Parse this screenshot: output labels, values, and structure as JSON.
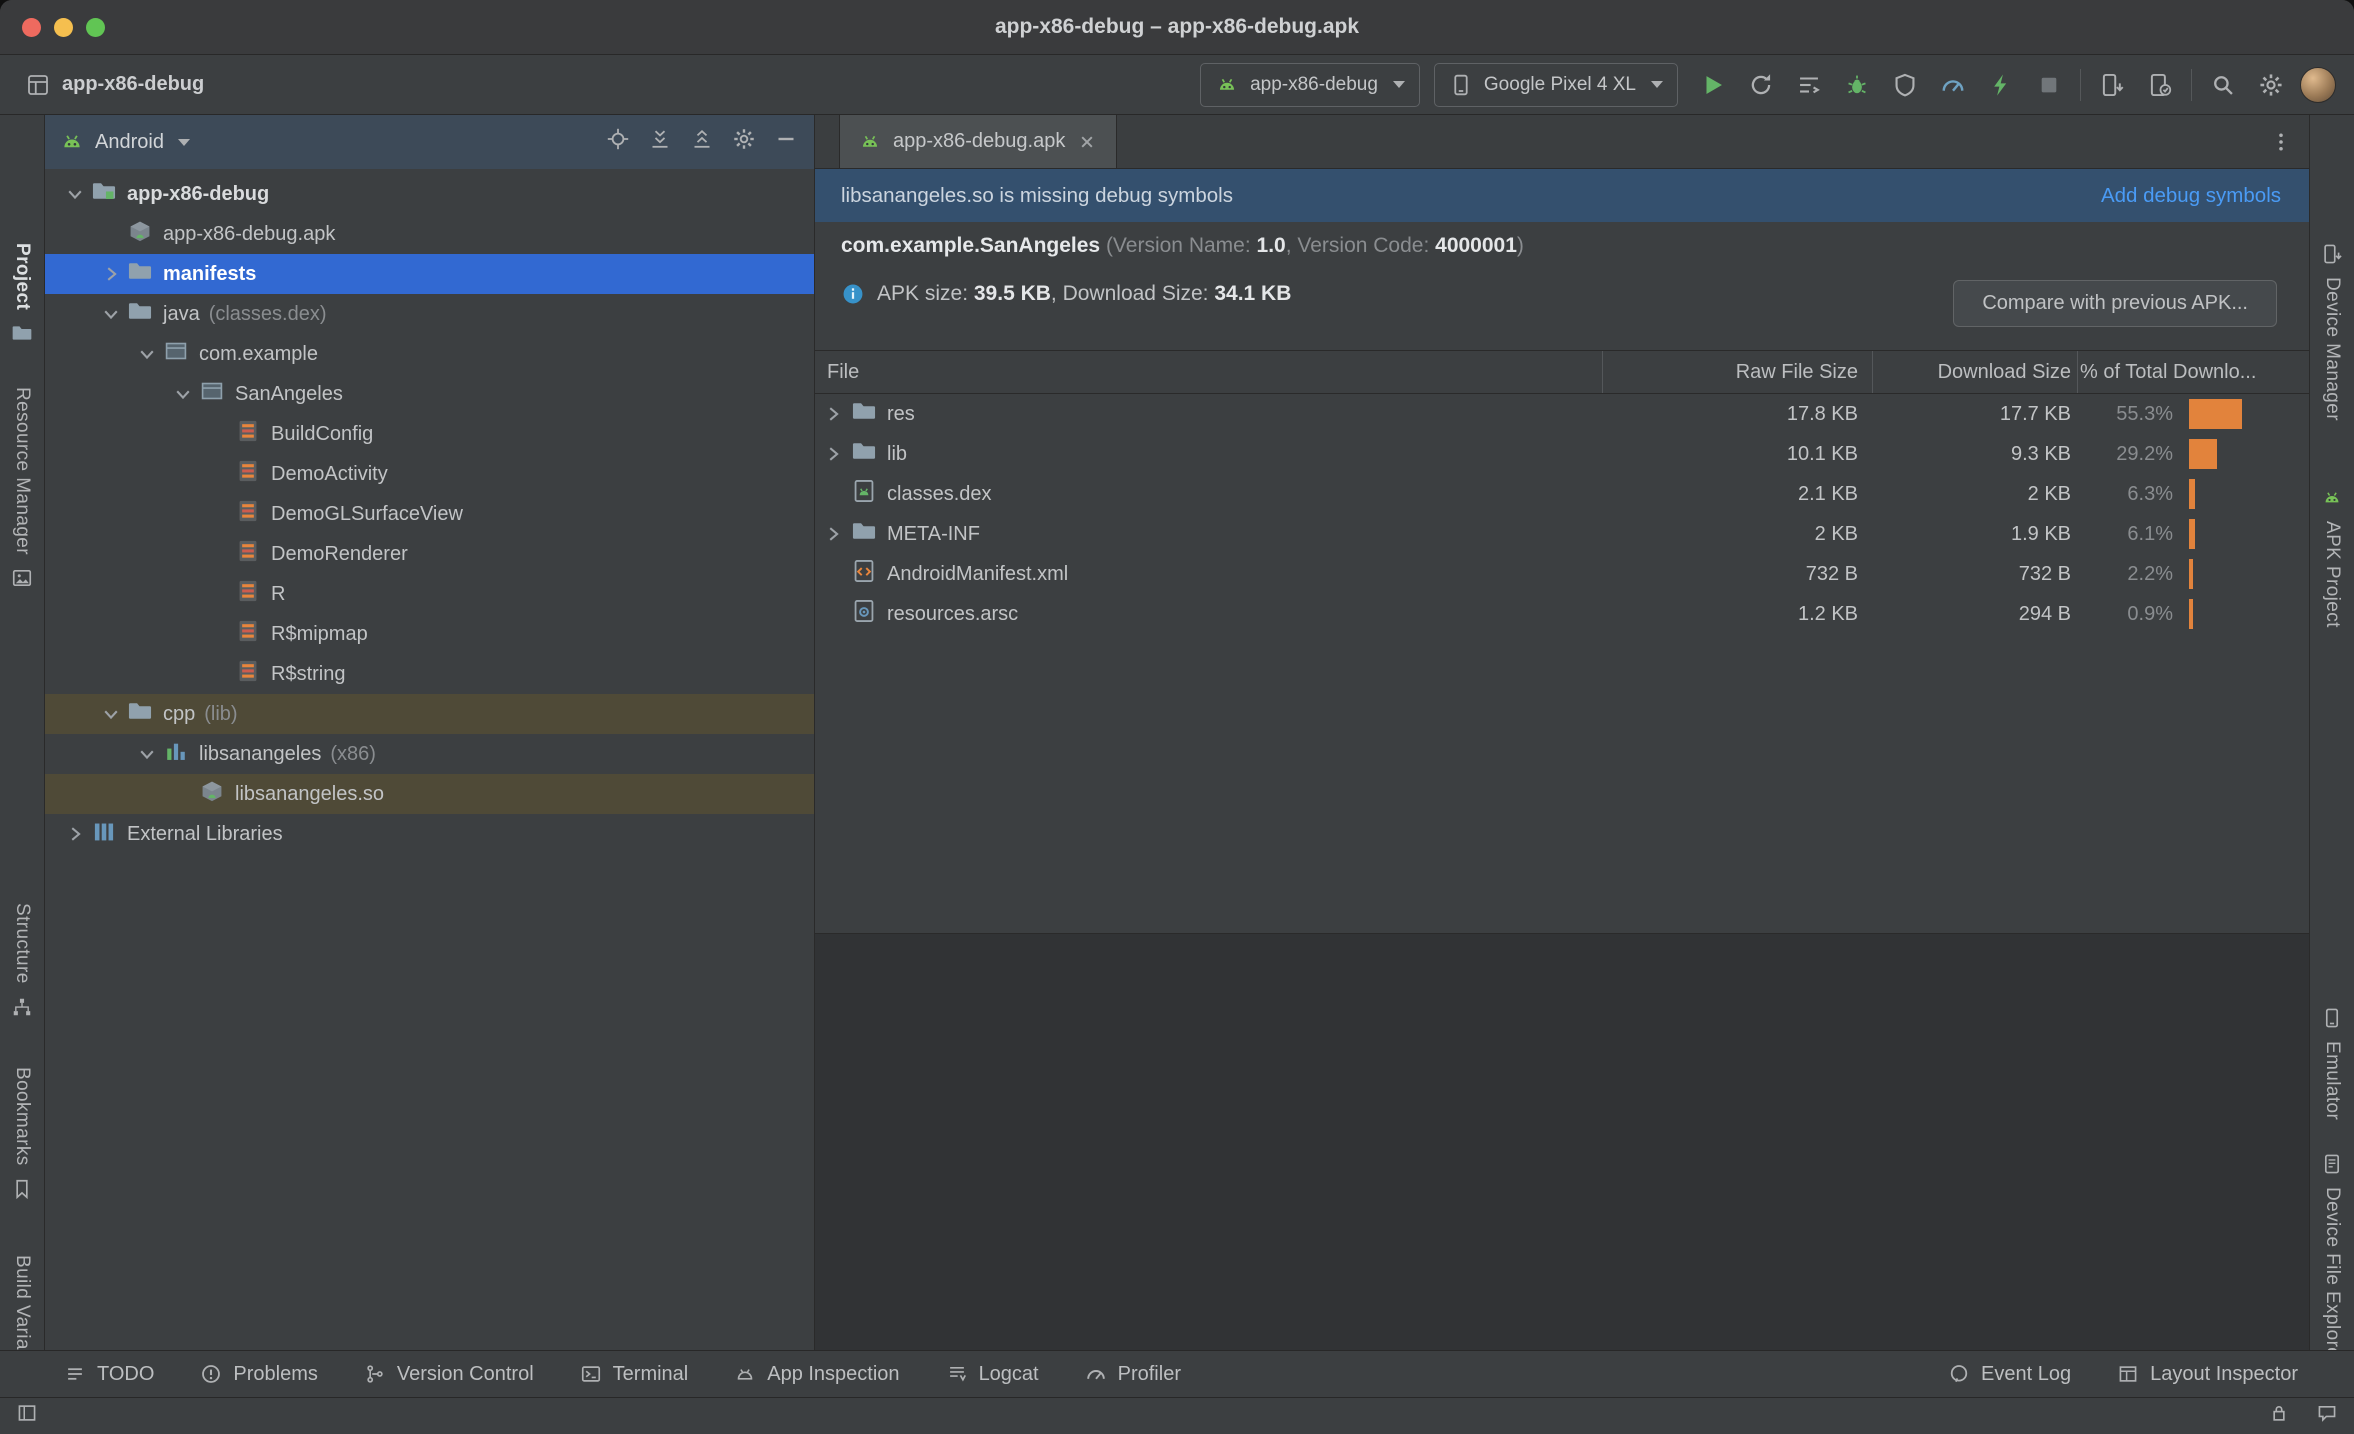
{
  "window": {
    "title": "app-x86-debug – app-x86-debug.apk"
  },
  "colors": {
    "selection_blue": "#3269d2",
    "flag_olive": "#4f4a37",
    "attention_orange": "#e2833c",
    "link_blue": "#4a9bf5",
    "banner_blue": "#34506e",
    "android_green": "#78c257"
  },
  "toolbar": {
    "project_name": "app-x86-debug",
    "run_config": {
      "label": "app-x86-debug",
      "icon": "android-icon"
    },
    "device_selector": {
      "label": "Google Pixel 4 XL",
      "icon": "phone-icon"
    },
    "action_icons": [
      "run-icon",
      "apply-changes-icon",
      "apply-code-changes-icon",
      "debug-icon",
      "attach-debugger-icon",
      "profile-icon",
      "profile-low-overhead-icon",
      "stop-icon"
    ],
    "device_icons": [
      "device-manager-icon",
      "running-devices-icon"
    ],
    "global_icons": [
      "search-icon",
      "settings-icon"
    ]
  },
  "left_stripe": {
    "items": [
      {
        "label": "Project",
        "icon": "folder-icon",
        "active": true
      },
      {
        "label": "Resource Manager",
        "icon": "resource-manager-icon"
      },
      {
        "label": "Structure",
        "icon": "structure-icon"
      },
      {
        "label": "Bookmarks",
        "icon": "bookmarks-icon"
      },
      {
        "label": "Build Variants",
        "icon": "build-variants-icon"
      }
    ]
  },
  "right_stripe": {
    "items": [
      {
        "label": "Device Manager",
        "icon": "device-manager-icon"
      },
      {
        "label": "APK Project",
        "icon": "android-icon"
      },
      {
        "label": "Emulator",
        "icon": "phone-icon"
      },
      {
        "label": "Device File Explorer",
        "icon": "device-file-explorer-icon"
      }
    ]
  },
  "project_panel": {
    "view_selector": "Android",
    "header_icons": [
      "locate-icon",
      "expand-all-icon",
      "collapse-all-icon",
      "settings-icon",
      "hide-icon"
    ],
    "tree": [
      {
        "label": "app-x86-debug",
        "level": 0,
        "chevron": "down",
        "icon": "module-icon",
        "bold": true
      },
      {
        "label": "app-x86-debug.apk",
        "level": 1,
        "chevron": null,
        "icon": "apk-icon"
      },
      {
        "label": "manifests",
        "level": 1,
        "chevron": "right",
        "icon": "folder-icon",
        "selected": true,
        "bold": true
      },
      {
        "label": "java",
        "suffix": "(classes.dex)",
        "level": 1,
        "chevron": "down",
        "icon": "folder-icon"
      },
      {
        "label": "com.example",
        "level": 2,
        "chevron": "down",
        "icon": "package-icon"
      },
      {
        "label": "SanAngeles",
        "level": 3,
        "chevron": "down",
        "icon": "package-icon"
      },
      {
        "label": "BuildConfig",
        "level": 4,
        "chevron": null,
        "icon": "class-icon"
      },
      {
        "label": "DemoActivity",
        "level": 4,
        "chevron": null,
        "icon": "class-icon"
      },
      {
        "label": "DemoGLSurfaceView",
        "level": 4,
        "chevron": null,
        "icon": "class-icon"
      },
      {
        "label": "DemoRenderer",
        "level": 4,
        "chevron": null,
        "icon": "class-icon"
      },
      {
        "label": "R",
        "level": 4,
        "chevron": null,
        "icon": "class-icon"
      },
      {
        "label": "R$mipmap",
        "level": 4,
        "chevron": null,
        "icon": "class-icon"
      },
      {
        "label": "R$string",
        "level": 4,
        "chevron": null,
        "icon": "class-icon"
      },
      {
        "label": "cpp",
        "suffix": "(lib)",
        "level": 1,
        "chevron": "down",
        "icon": "folder-icon",
        "flagged": true
      },
      {
        "label": "libsanangeles",
        "suffix": "(x86)",
        "level": 2,
        "chevron": "down",
        "icon": "lib-icon"
      },
      {
        "label": "libsanangeles.so",
        "level": 3,
        "chevron": null,
        "icon": "so-icon",
        "flagged": true
      },
      {
        "label": "External Libraries",
        "level": 0,
        "chevron": "right",
        "icon": "libraries-icon"
      }
    ]
  },
  "editor": {
    "tab": {
      "label": "app-x86-debug.apk"
    },
    "banner": {
      "message": "libsanangeles.so is missing debug symbols",
      "action": "Add debug symbols"
    },
    "apk_info": {
      "package": "com.example.SanAngeles",
      "version_name_label": " (Version Name: ",
      "version_name": "1.0",
      "version_code_label": ", Version Code: ",
      "version_code": "4000001",
      "close_paren": ")",
      "size_label": "APK size: ",
      "apk_size": "39.5 KB",
      "download_label": ", Download Size: ",
      "download_size": "34.1 KB",
      "compare_button": "Compare with previous APK..."
    },
    "table": {
      "columns": [
        "File",
        "Raw File Size",
        "Download Size",
        "% of Total Downlo..."
      ],
      "rows": [
        {
          "name": "res",
          "icon": "folder-icon",
          "chevron": true,
          "raw": "17.8 KB",
          "download": "17.7 KB",
          "pct": "55.3%",
          "pct_value": 55.3
        },
        {
          "name": "lib",
          "icon": "folder-icon",
          "chevron": true,
          "raw": "10.1 KB",
          "download": "9.3 KB",
          "pct": "29.2%",
          "pct_value": 29.2
        },
        {
          "name": "classes.dex",
          "icon": "dex-icon",
          "chevron": false,
          "raw": "2.1 KB",
          "download": "2 KB",
          "pct": "6.3%",
          "pct_value": 6.3
        },
        {
          "name": "META-INF",
          "icon": "folder-icon",
          "chevron": true,
          "raw": "2 KB",
          "download": "1.9 KB",
          "pct": "6.1%",
          "pct_value": 6.1
        },
        {
          "name": "AndroidManifest.xml",
          "icon": "manifest-icon",
          "chevron": false,
          "raw": "732 B",
          "download": "732 B",
          "pct": "2.2%",
          "pct_value": 2.2
        },
        {
          "name": "resources.arsc",
          "icon": "arsc-icon",
          "chevron": false,
          "raw": "1.2 KB",
          "download": "294 B",
          "pct": "0.9%",
          "pct_value": 0.9
        }
      ]
    }
  },
  "bottom_bar": {
    "left": [
      {
        "label": "TODO",
        "icon": "todo-icon"
      },
      {
        "label": "Problems",
        "icon": "problems-icon"
      },
      {
        "label": "Version Control",
        "icon": "version-control-icon"
      },
      {
        "label": "Terminal",
        "icon": "terminal-icon"
      },
      {
        "label": "App Inspection",
        "icon": "app-inspection-icon"
      },
      {
        "label": "Logcat",
        "icon": "logcat-icon"
      },
      {
        "label": "Profiler",
        "icon": "profiler-icon"
      }
    ],
    "right": [
      {
        "label": "Event Log",
        "icon": "event-log-icon"
      },
      {
        "label": "Layout Inspector",
        "icon": "layout-inspector-icon"
      }
    ]
  },
  "status_bar": {
    "left_icons": [
      "toolwindows-icon"
    ],
    "right_icons": [
      "lock-icon",
      "notifications-icon"
    ]
  }
}
